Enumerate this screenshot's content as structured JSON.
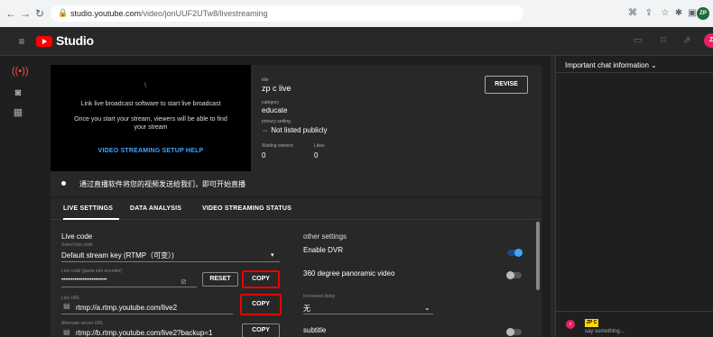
{
  "browser": {
    "url_host": "studio.youtube.com",
    "url_path": "/video/jonUUF2UTw8/livestreaming",
    "profile_initials": "ZP"
  },
  "app": {
    "name": "Studio"
  },
  "preview": {
    "spinner": "\\",
    "title": "Link live broadcast software to start live broadcast",
    "description": "Once you start your stream, viewers will be able to find your stream",
    "help_link": "VIDEO STREAMING SETUP HELP"
  },
  "info": {
    "title_label": "title",
    "title_value": "zp c live",
    "category_label": "category",
    "category_value": "educate",
    "privacy_label": "privacy setting",
    "privacy_value": "Not listed publicly",
    "waiting_label": "Waiting viewers",
    "waiting_value": "0",
    "likes_label": "Likes",
    "likes_value": "0",
    "revise_label": "REVISE"
  },
  "status": {
    "text": "通过直播软件将您的视频发送给我们，即可开始直播"
  },
  "tabs": [
    {
      "label": "LIVE SETTINGS",
      "active": true
    },
    {
      "label": "DATA ANALYSIS",
      "active": false
    },
    {
      "label": "VIDEO STREAMING STATUS",
      "active": false
    }
  ],
  "live_code": {
    "section_title": "Live code",
    "select_label": "Select live code",
    "select_value": "Default stream key (RTMP（可变）)",
    "key_label": "Live code (paste into encoder)",
    "key_value": "••••••••••••••••••••••••",
    "reset_label": "RESET",
    "copy_label": "COPY",
    "url_label": "Live URL",
    "url_value": "rtmp://a.rtmp.youtube.com/live2",
    "url_copy_label": "COPY",
    "alt_label": "Alternate server URL",
    "alt_value": "rtmp://b.rtmp.youtube.com/live2?backup=1",
    "alt_copy_label": "COPY"
  },
  "other": {
    "section_title": "other settings",
    "dvr_label": "Enable DVR",
    "dvr_on": true,
    "pano_label": "360 degree panoramic video",
    "pano_on": false,
    "delay_label": "Increased delay",
    "delay_value": "无",
    "subtitle_label": "subtitle",
    "subtitle_on": false
  },
  "chat": {
    "header": "Important chat information",
    "user_initial": "z",
    "user_badge": "ZP C",
    "placeholder": "say something..."
  },
  "colors": {
    "accent": "#3ea6ff",
    "brand": "#ff0000",
    "highlight": "#ee0000"
  }
}
